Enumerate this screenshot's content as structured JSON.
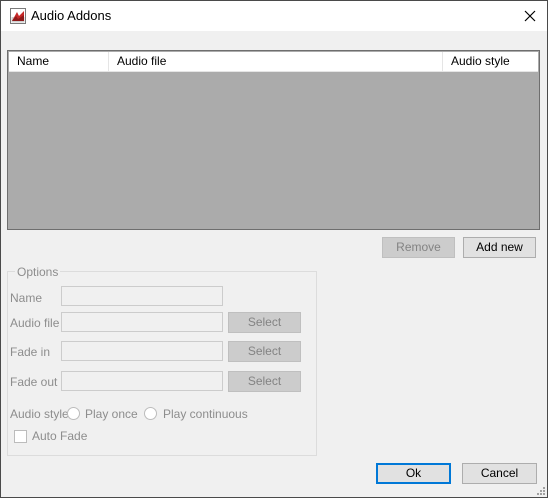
{
  "window": {
    "title": "Audio Addons"
  },
  "list": {
    "columns": [
      "Name",
      "Audio file",
      "Audio style"
    ]
  },
  "list_buttons": {
    "remove": "Remove",
    "add_new": "Add new"
  },
  "options": {
    "title": "Options",
    "name_label": "Name",
    "name_value": "",
    "audio_file_label": "Audio file",
    "audio_file_value": "",
    "fade_in_label": "Fade in",
    "fade_in_value": "",
    "fade_out_label": "Fade out",
    "fade_out_value": "",
    "select_label": "Select",
    "audio_style_label": "Audio style",
    "play_once": "Play once",
    "play_continuous": "Play continuous",
    "auto_fade": "Auto Fade"
  },
  "footer": {
    "ok": "Ok",
    "cancel": "Cancel"
  }
}
